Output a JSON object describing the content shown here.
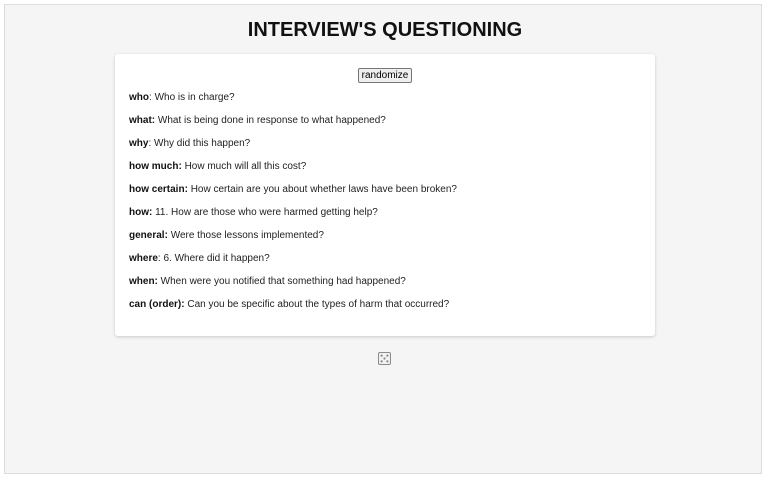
{
  "page": {
    "title": "INTERVIEW'S QUESTIONING"
  },
  "controls": {
    "randomize_label": "randomize",
    "dice_icon": "dice-icon"
  },
  "questions": [
    {
      "key": "who",
      "sep": ": ",
      "text": "Who is in charge?"
    },
    {
      "key": "what:",
      "sep": " ",
      "text": "What is being done in response to what happened?"
    },
    {
      "key": "why",
      "sep": ": ",
      "text": "Why did this happen?"
    },
    {
      "key": "how much:",
      "sep": " ",
      "text": "How much will all this cost?"
    },
    {
      "key": "how certain:",
      "sep": " ",
      "text": "How certain are you about whether laws have been broken?"
    },
    {
      "key": "how:",
      "sep": " ",
      "text": "11. How are those who were harmed getting help?"
    },
    {
      "key": "general:",
      "sep": " ",
      "text": "Were those lessons implemented?"
    },
    {
      "key": "where",
      "sep": ": ",
      "text": "6. Where did it happen?"
    },
    {
      "key": "when:",
      "sep": " ",
      "text": "When were you notified that something had happened?"
    },
    {
      "key": "can (order):",
      "sep": " ",
      "text": "Can you be specific about the types of harm that occurred?"
    }
  ]
}
